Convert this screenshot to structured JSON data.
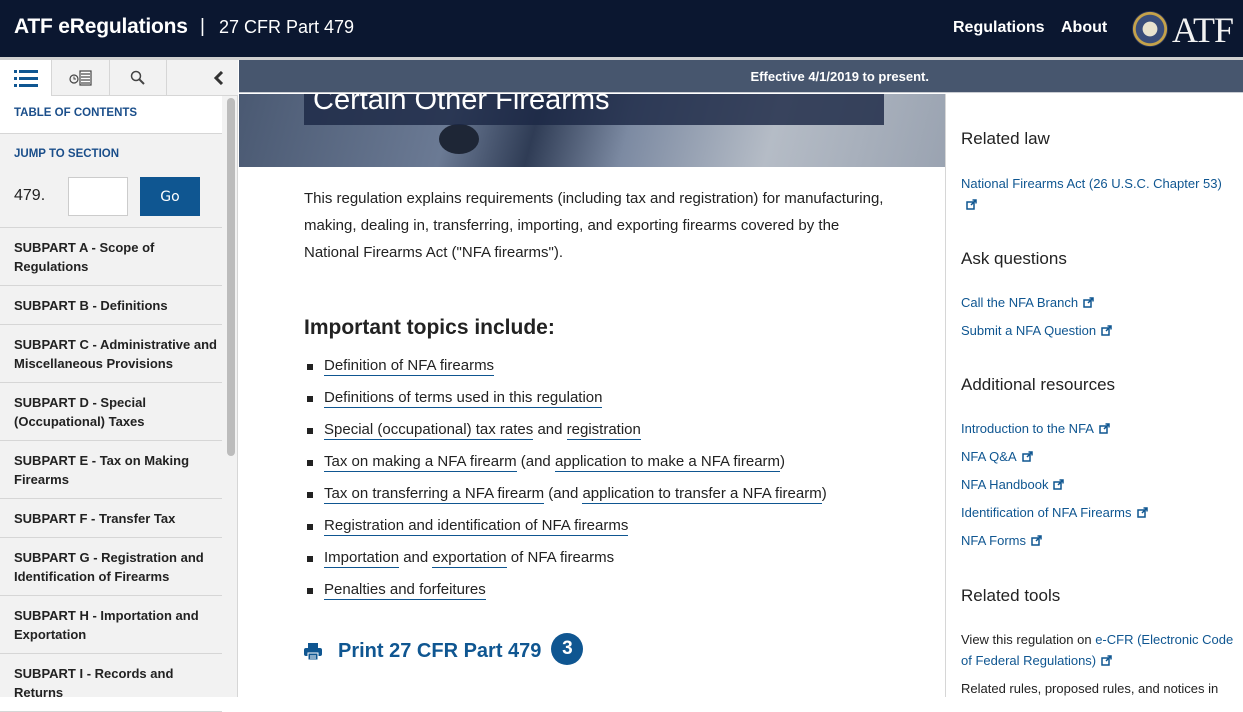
{
  "header": {
    "brand": "ATF eRegulations",
    "separator": "|",
    "part": "27 CFR Part 479",
    "nav": [
      "Regulations",
      "About"
    ],
    "logo_text": "ATF"
  },
  "sidebar": {
    "tabs": [
      {
        "name": "table-of-contents",
        "icon": "list-icon",
        "active": true
      },
      {
        "name": "timeline",
        "icon": "history-icon",
        "active": false
      },
      {
        "name": "search",
        "icon": "search-icon",
        "active": false
      },
      {
        "name": "collapse",
        "icon": "chevron-left-icon",
        "active": false
      }
    ],
    "toc_heading": "TABLE OF CONTENTS",
    "jump_label": "JUMP TO SECTION",
    "jump_prefix": "479.",
    "jump_value": "",
    "go_label": "Go",
    "items": [
      "SUBPART A - Scope of Regulations",
      "SUBPART B - Definitions",
      "SUBPART C - Administrative and Miscellaneous Provisions",
      "SUBPART D - Special (Occupational) Taxes",
      "SUBPART E - Tax on Making Firearms",
      "SUBPART F - Transfer Tax",
      "SUBPART G - Registration and Identification of Firearms",
      "SUBPART H - Importation and Exportation",
      "SUBPART I - Records and Returns"
    ]
  },
  "effective": "Effective 4/1/2019 to present.",
  "hero_title": "Certain Other Firearms",
  "main": {
    "intro": "This regulation explains requirements (including tax and registration) for manufacturing, making, dealing in, transferring, importing, and exporting firearms covered by the National Firearms Act (\"NFA firearms\").",
    "topics_heading": "Important topics include:",
    "topics": [
      [
        {
          "t": "Definition of NFA firearms",
          "link": true
        }
      ],
      [
        {
          "t": "Definitions of terms used in this regulation",
          "link": true
        }
      ],
      [
        {
          "t": "Special (occupational) tax rates",
          "link": true
        },
        {
          "t": " and ",
          "link": false
        },
        {
          "t": "registration",
          "link": true
        }
      ],
      [
        {
          "t": "Tax on making a NFA firearm",
          "link": true
        },
        {
          "t": " (and ",
          "link": false
        },
        {
          "t": "application to make a NFA firearm",
          "link": true
        },
        {
          "t": ")",
          "link": false
        }
      ],
      [
        {
          "t": "Tax on transferring a NFA firearm",
          "link": true
        },
        {
          "t": " (and ",
          "link": false
        },
        {
          "t": "application to transfer a NFA firearm",
          "link": true
        },
        {
          "t": ")",
          "link": false
        }
      ],
      [
        {
          "t": "Registration and identification of NFA firearms",
          "link": true
        }
      ],
      [
        {
          "t": "Importation",
          "link": true
        },
        {
          "t": " and ",
          "link": false
        },
        {
          "t": "exportation",
          "link": true
        },
        {
          "t": " of NFA firearms",
          "link": false
        }
      ],
      [
        {
          "t": "Penalties and forfeitures",
          "link": true
        }
      ]
    ],
    "print_label": "Print 27 CFR Part 479",
    "print_badge": "3"
  },
  "right": {
    "related_law_heading": "Related law",
    "related_law_link": "National Firearms Act (26 U.S.C. Chapter 53)",
    "ask_heading": "Ask questions",
    "ask_links": [
      "Call the NFA Branch",
      "Submit a NFA Question"
    ],
    "resources_heading": "Additional resources",
    "resources_links": [
      "Introduction to the NFA",
      "NFA Q&A",
      "NFA Handbook",
      "Identification of NFA Firearms",
      "NFA Forms"
    ],
    "tools_heading": "Related tools",
    "tools_text_prefix": "View this regulation on ",
    "tools_link": "e-CFR (Electronic Code of Federal Regulations)",
    "tools_text2": "Related rules, proposed rules, and notices in"
  },
  "colors": {
    "header_bg": "#0b1730",
    "accent": "#0f5691",
    "effective_bar": "#47566e"
  }
}
